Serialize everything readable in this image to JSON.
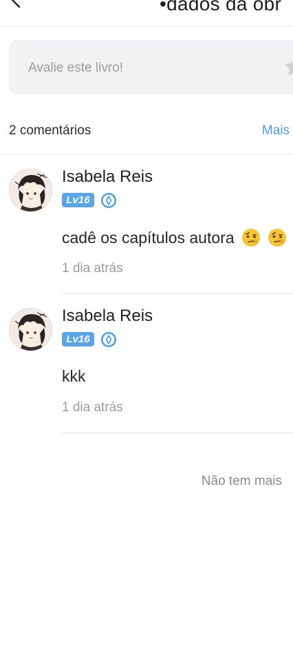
{
  "header": {
    "title": "•dados da obr",
    "back_icon": "chevron-left-icon"
  },
  "rating": {
    "placeholder": "Avalie este livro!",
    "icon": "star-icon"
  },
  "comments_section": {
    "count_label": "2 comentários",
    "more_label": "Mais"
  },
  "comments": [
    {
      "username": "Isabela Reis",
      "level": "Lv16",
      "rank_icon": "rank-icon",
      "text": "cadê os capítulos autora",
      "emoji": [
        "raised-eyebrow-emoji",
        "raised-eyebrow-emoji"
      ],
      "time": "1 dia atrás"
    },
    {
      "username": "Isabela Reis",
      "level": "Lv16",
      "rank_icon": "rank-icon",
      "text": "kkk",
      "time": "1 dia atrás"
    }
  ],
  "footer": {
    "no_more_label": "Não tem mais"
  },
  "colors": {
    "accent": "#4a9ee8",
    "badge": "#5aa4ec",
    "input_bg": "#f2f2f4"
  }
}
